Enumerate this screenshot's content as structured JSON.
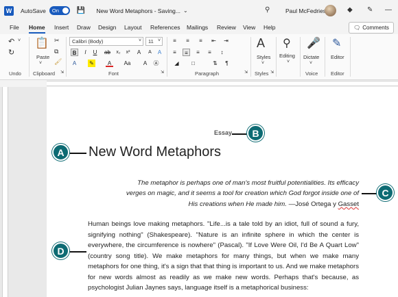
{
  "titlebar": {
    "autosave_label": "AutoSave",
    "autosave_state": "On",
    "doc_title": "New Word Metaphors - Saving...",
    "user_name": "Paul McFedries"
  },
  "tabs": [
    "File",
    "Home",
    "Insert",
    "Draw",
    "Design",
    "Layout",
    "References",
    "Mailings",
    "Review",
    "View",
    "Help"
  ],
  "active_tab": "Home",
  "comments_label": "Comments",
  "ribbon": {
    "undo_label": "Undo",
    "clipboard_label": "Clipboard",
    "paste_label": "Paste",
    "font_label": "Font",
    "font_name": "Calibri (Body)",
    "font_size": "11",
    "paragraph_label": "Paragraph",
    "styles_label": "Styles",
    "styles_group_label": "Styles",
    "editing_label": "Editing",
    "dictate_label": "Dictate",
    "voice_label": "Voice",
    "editor_label": "Editor",
    "editor_group_label": "Editor"
  },
  "document": {
    "essay": "Essay",
    "heading": "New Word Metaphors",
    "quote_line1": "The metaphor is perhaps one of man's most fruitful potentialities. Its efficacy",
    "quote_line2": "verges on magic, and it seems a tool for creation which God forgot inside one of",
    "quote_line3": "His creations when He made him.",
    "quote_author_pre": " —José Ortega y ",
    "quote_author_last": "Gasset",
    "body": "Human beings love making metaphors. \"Life...is a tale told by an idiot, full of sound a fury, signifying nothing\" (Shakespeare). \"Nature is an infinite sphere in which the center is everywhere, the circumference is nowhere\" (Pascal). \"If Love Were Oil, I'd Be A Quart Low\" (country song title). We make metaphors for many things, but when we make many metaphors for one thing, it's a sign that that thing is important to us. And we make metaphors for new words almost as readily as we make new words. Perhaps that's because, as psychologist Julian Jaynes says, language itself is a metaphorical business:"
  },
  "callouts": [
    "A",
    "B",
    "C",
    "D"
  ]
}
